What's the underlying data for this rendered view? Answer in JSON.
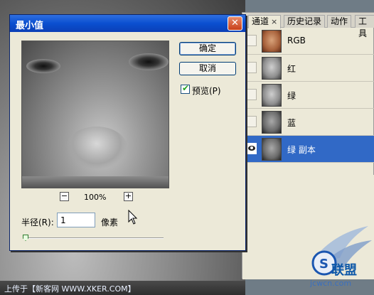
{
  "dialog": {
    "title": "最小值",
    "ok_label": "确定",
    "cancel_label": "取消",
    "preview_label": "预览(P)",
    "preview_checked": true,
    "zoom_minus": "−",
    "zoom_plus": "+",
    "zoom_value": "100%",
    "radius_label": "半径(R):",
    "radius_value": "1",
    "radius_unit": "像素"
  },
  "panel": {
    "tabs": [
      {
        "label": "通道",
        "close": "×"
      },
      {
        "label": "历史记录"
      },
      {
        "label": "动作"
      },
      {
        "label": "工具"
      }
    ],
    "channels": [
      {
        "label": "RGB"
      },
      {
        "label": "红"
      },
      {
        "label": "绿"
      },
      {
        "label": "蓝"
      },
      {
        "label": "绿 副本"
      }
    ]
  },
  "watermark": {
    "bottom_text": "上传于【新客网 WWW.XKER.COM】",
    "logo_text": "联盟",
    "logo_url": "jcwcn.com"
  },
  "colors": {
    "selection": "#3169c6",
    "titlebar": "#0a4fd0",
    "dialog_bg": "#ece9d8"
  }
}
